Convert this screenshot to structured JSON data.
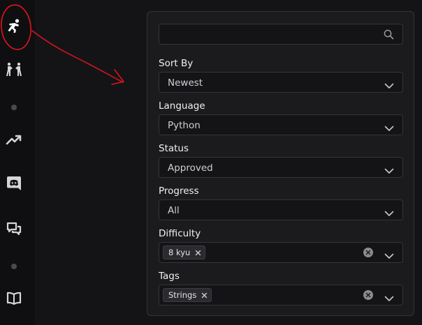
{
  "sidebar": {
    "items": [
      {
        "icon": "kata-logo-icon"
      },
      {
        "icon": "sparring-icon"
      },
      {
        "icon": "trending-icon"
      },
      {
        "icon": "discord-icon"
      },
      {
        "icon": "chat-bubbles-icon"
      },
      {
        "icon": "book-icon"
      }
    ]
  },
  "filters": {
    "search": {
      "value": "",
      "placeholder": ""
    },
    "sort_by": {
      "label": "Sort By",
      "value": "Newest"
    },
    "language": {
      "label": "Language",
      "value": "Python"
    },
    "status": {
      "label": "Status",
      "value": "Approved"
    },
    "progress": {
      "label": "Progress",
      "value": "All"
    },
    "difficulty": {
      "label": "Difficulty",
      "chips": [
        "8 kyu"
      ]
    },
    "tags": {
      "label": "Tags",
      "chips": [
        "Strings"
      ]
    }
  },
  "colors": {
    "background": "#141416",
    "panel": "#1b1b1e",
    "annotation": "#e0141e"
  }
}
